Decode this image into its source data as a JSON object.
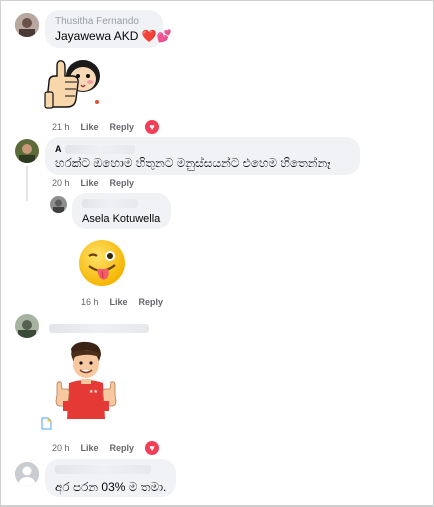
{
  "comments": [
    {
      "name": "Thusitha Fernando",
      "text": "Jayawewa AKD ❤️💕",
      "time": "21 h",
      "like": "Like",
      "reply": "Reply",
      "reaction_icon": "love-reaction-icon"
    },
    {
      "name": "A",
      "text": "හරක්ට ඔහොම හිතුනට මනුස්සයන්ට එහෙම හිතෙන්නෑ",
      "time": "20 h",
      "like": "Like",
      "reply": "Reply",
      "reply_item": {
        "name": "",
        "text": "Asela Kotuwella",
        "time": "16 h",
        "like": "Like",
        "reply": "Reply",
        "sticker": "winking-tongue-emoji"
      }
    },
    {
      "name": "",
      "time": "20 h",
      "like": "Like",
      "reply": "Reply",
      "sticker": "cartoon-man-thumbs-up",
      "reaction_icon": "love-reaction-icon"
    },
    {
      "name": "",
      "text": "අර පරන 03% ම තමා.",
      "avatar": "default-user-icon"
    }
  ],
  "colors": {
    "bubble": "#f0f2f5",
    "meta_text": "#65676b",
    "love": "#f33e58"
  }
}
